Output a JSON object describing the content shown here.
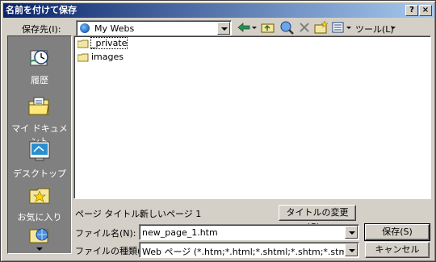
{
  "window": {
    "title": "名前を付けて保存",
    "help_label": "?",
    "close_label": "×"
  },
  "save_in": {
    "label": "保存先(I):",
    "value": "My Webs"
  },
  "toolbar": {
    "tools_label": "ツール(L)"
  },
  "sidebar": {
    "items": [
      {
        "label": "履歴",
        "icon": "history-icon"
      },
      {
        "label": "マイ ドキュメント",
        "icon": "my-documents-icon"
      },
      {
        "label": "デスクトップ",
        "icon": "desktop-icon"
      },
      {
        "label": "お気に入り",
        "icon": "favorites-icon"
      }
    ]
  },
  "files": [
    {
      "name": "_private",
      "icon": "folder-icon"
    },
    {
      "name": "images",
      "icon": "folder-icon"
    }
  ],
  "page_title": {
    "label": "ページ タイトル:",
    "value": "新しいページ 1",
    "change_button": "タイトルの変更(C)..."
  },
  "file_name": {
    "label": "ファイル名(N):",
    "value": "new_page_1.htm"
  },
  "file_type": {
    "label": "ファイルの種類(T):",
    "value": "Web ページ (*.htm;*.html;*.shtml;*.shtm;*.stm;*.asp;*.asp"
  },
  "buttons": {
    "save": "保存(S)",
    "cancel": "キャンセル"
  },
  "colors": {
    "titlebar_start": "#0a246a",
    "titlebar_end": "#a6caf0",
    "face": "#d4d0c8",
    "sidebar": "#808080"
  }
}
